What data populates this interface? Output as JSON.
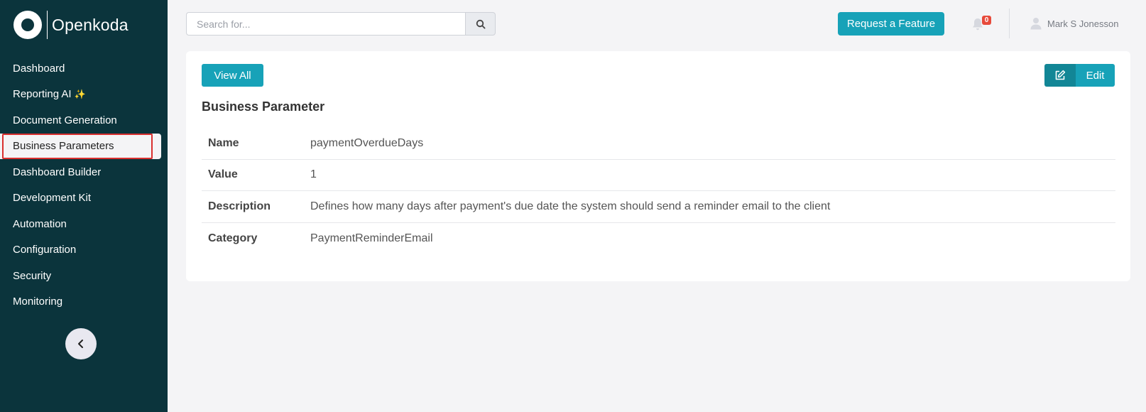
{
  "brand": {
    "name": "Openkoda"
  },
  "sidebar": {
    "items": [
      {
        "label": "Dashboard"
      },
      {
        "label": "Reporting AI",
        "emoji": "✨"
      },
      {
        "label": "Document Generation"
      },
      {
        "label": "Business Parameters",
        "active": true
      },
      {
        "label": "Dashboard Builder"
      },
      {
        "label": "Development Kit"
      },
      {
        "label": "Automation"
      },
      {
        "label": "Configuration"
      },
      {
        "label": "Security"
      },
      {
        "label": "Monitoring"
      }
    ],
    "collapse_icon": "chevron-left-icon"
  },
  "topbar": {
    "search_placeholder": "Search for...",
    "search_icon": "search-icon",
    "request_feature_label": "Request a Feature",
    "notifications_count": "0",
    "user_name": "Mark S Jonesson"
  },
  "card": {
    "view_all_label": "View All",
    "edit_label": "Edit",
    "title": "Business Parameter",
    "rows": [
      {
        "label": "Name",
        "value": "paymentOverdueDays"
      },
      {
        "label": "Value",
        "value": "1"
      },
      {
        "label": "Description",
        "value": "Defines how many days after payment's due date the system should send a reminder email to the client"
      },
      {
        "label": "Category",
        "value": "PaymentReminderEmail"
      }
    ]
  },
  "colors": {
    "sidebar_bg": "#0b343c",
    "accent": "#17a2b8",
    "accent_dark": "#128696",
    "badge": "#e74a3b",
    "highlight": "#d9302f"
  }
}
